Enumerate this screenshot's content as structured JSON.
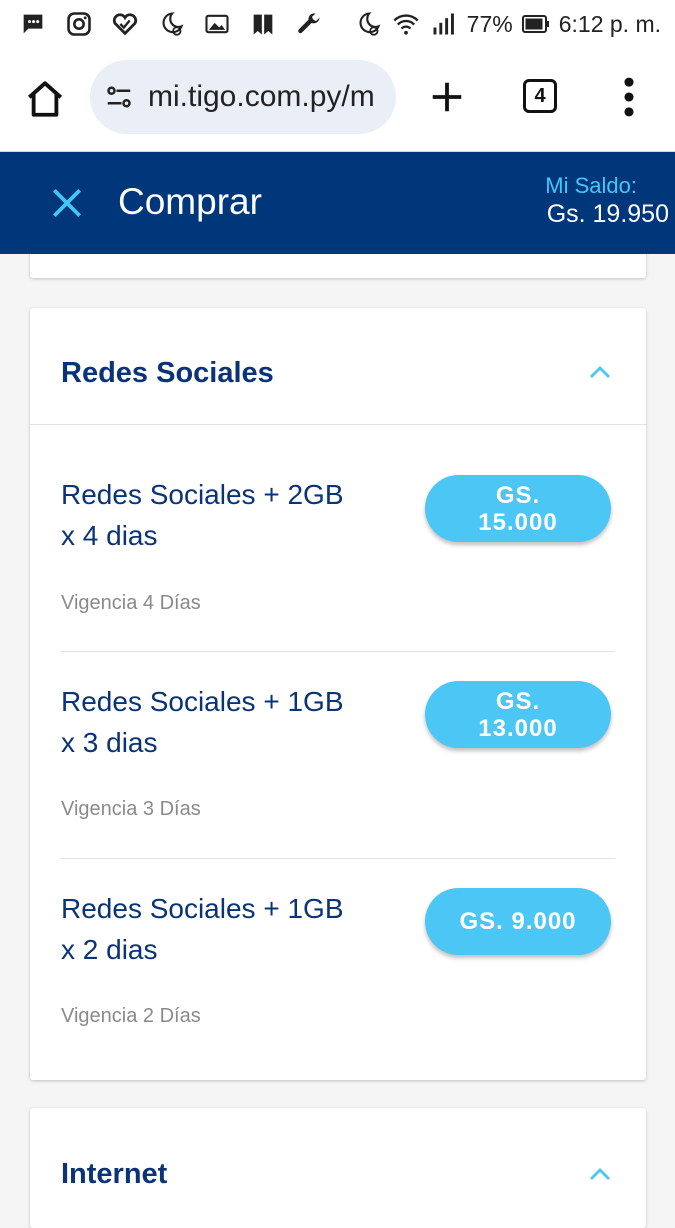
{
  "status_bar": {
    "battery": "77%",
    "time": "6:12 p. m."
  },
  "browser": {
    "url": "mi.tigo.com.py/m",
    "tab_count": "4"
  },
  "header": {
    "title": "Comprar",
    "saldo_label": "Mi Saldo:",
    "saldo_value": "Gs. 19.950"
  },
  "sections": {
    "redes": {
      "title": "Redes Sociales",
      "offers": [
        {
          "name_line1": "Redes Sociales + 2GB",
          "name_line2": "x 4 dias",
          "vigencia": "Vigencia 4 Días",
          "price_line1": "GS.",
          "price_line2": "15.000"
        },
        {
          "name_line1": "Redes Sociales + 1GB",
          "name_line2": "x 3 dias",
          "vigencia": "Vigencia 3 Días",
          "price_line1": "GS.",
          "price_line2": "13.000"
        },
        {
          "name_line1": "Redes Sociales + 1GB",
          "name_line2": "x 2 dias",
          "vigencia": "Vigencia 2 Días",
          "price": "GS. 9.000"
        }
      ]
    },
    "internet": {
      "title": "Internet"
    }
  },
  "colors": {
    "header_bg": "#00377b",
    "accent": "#4cc6f4",
    "title_text": "#0b3377"
  }
}
